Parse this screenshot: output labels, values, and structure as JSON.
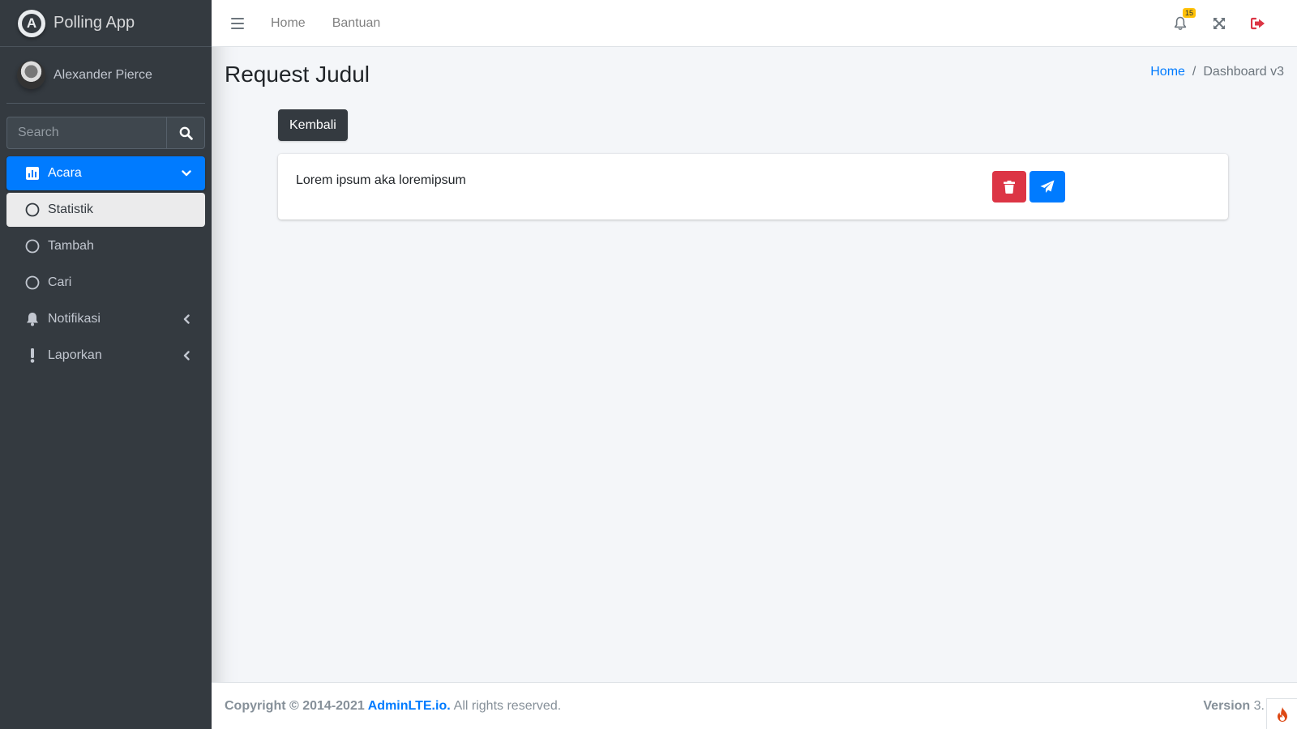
{
  "brand": {
    "name": "Polling App",
    "logo_letter": "A"
  },
  "user": {
    "name": "Alexander Pierce"
  },
  "search": {
    "placeholder": "Search"
  },
  "sidebar": {
    "items": [
      {
        "label": "Acara",
        "icon": "chart-bar-icon"
      },
      {
        "label": "Statistik",
        "icon": "circle-icon"
      },
      {
        "label": "Tambah",
        "icon": "circle-icon"
      },
      {
        "label": "Cari",
        "icon": "circle-icon"
      },
      {
        "label": "Notifikasi",
        "icon": "bell-icon"
      },
      {
        "label": "Laporkan",
        "icon": "exclamation-icon"
      }
    ]
  },
  "topbar": {
    "links": [
      "Home",
      "Bantuan"
    ],
    "notification_count": "15"
  },
  "page": {
    "title": "Request Judul",
    "breadcrumb": [
      "Home",
      "Dashboard v3"
    ],
    "back_label": "Kembali",
    "card_text": "Lorem ipsum aka loremipsum"
  },
  "footer": {
    "copyright": "Copyright © 2014-2021",
    "brand_link": "AdminLTE.io.",
    "rights": "All rights reserved.",
    "version_label": "Version",
    "version_value": "3."
  },
  "colors": {
    "sidebar_bg": "#343a40",
    "primary": "#007bff",
    "danger": "#dc3545",
    "warning": "#ffc107",
    "dark": "#343a40"
  }
}
